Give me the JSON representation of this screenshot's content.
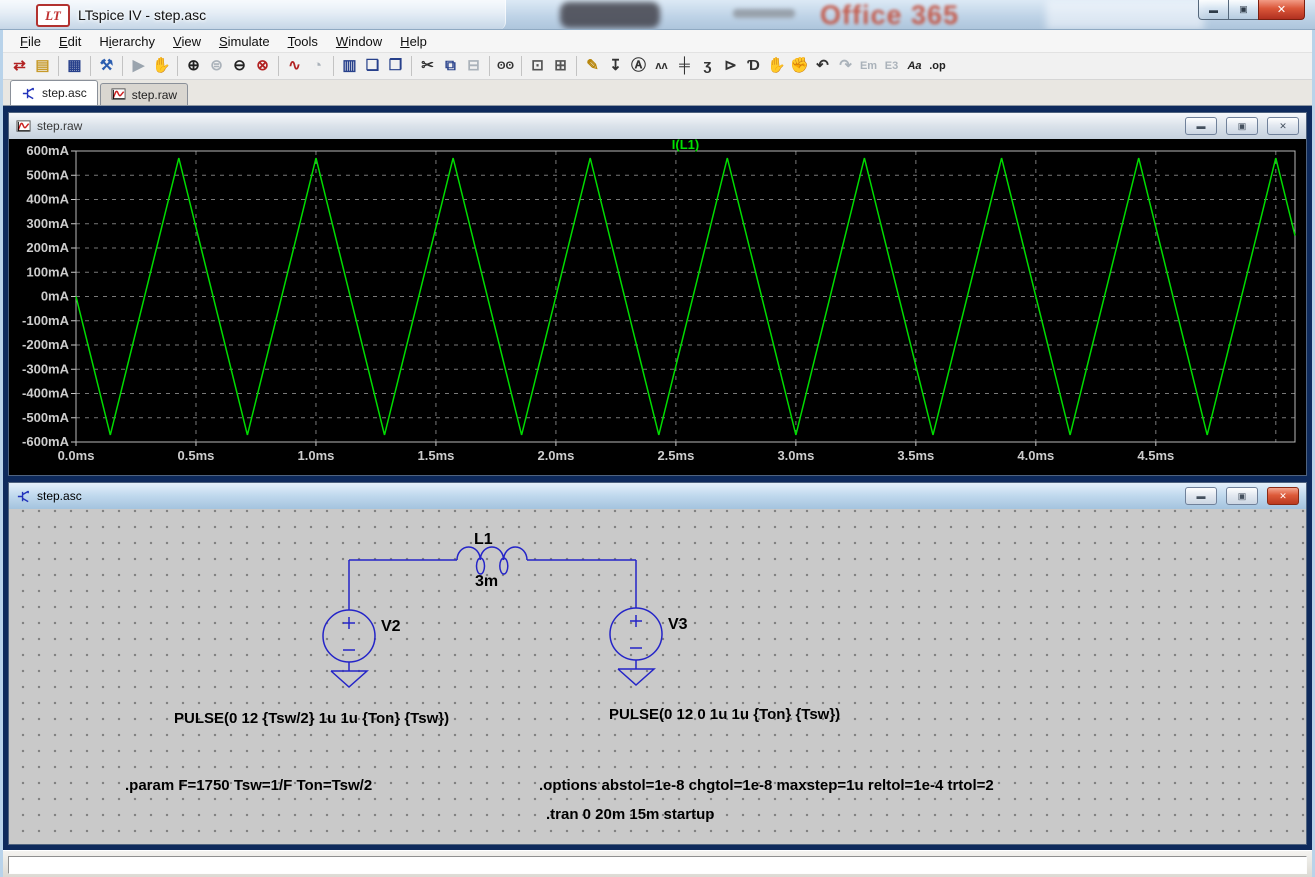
{
  "window": {
    "title": "LTspice IV - step.asc",
    "logo_text": "LT",
    "background": {
      "office_text": "Office 365"
    },
    "controls": {
      "minimize_glyph": "▬",
      "restore_glyph": "▣",
      "close_glyph": "✕"
    }
  },
  "menu": {
    "items": [
      {
        "label": "File",
        "u": 0
      },
      {
        "label": "Edit",
        "u": 0
      },
      {
        "label": "Hierarchy",
        "u": 1
      },
      {
        "label": "View",
        "u": 0
      },
      {
        "label": "Simulate",
        "u": 0
      },
      {
        "label": "Tools",
        "u": 0
      },
      {
        "label": "Window",
        "u": 0
      },
      {
        "label": "Help",
        "u": 0
      }
    ]
  },
  "toolbar": {
    "icons": [
      {
        "name": "new-schematic-button",
        "glyph": "⇄",
        "color": "#b22222"
      },
      {
        "name": "open-file-button",
        "glyph": "▤",
        "color": "#c79a2a"
      },
      {
        "sep": true
      },
      {
        "name": "save-button",
        "glyph": "▦",
        "color": "#27408b"
      },
      {
        "sep": true
      },
      {
        "name": "control-panel-button",
        "glyph": "⚒",
        "color": "#2a5db0"
      },
      {
        "sep": true
      },
      {
        "name": "run-button",
        "glyph": "▶",
        "color": "#9aa4ae",
        "disabled": true
      },
      {
        "name": "halt-button",
        "glyph": "✋",
        "color": "#9aa4ae",
        "disabled": true
      },
      {
        "sep": true
      },
      {
        "name": "zoom-in-button",
        "glyph": "⊕",
        "color": "#222222"
      },
      {
        "name": "zoom-previous-button",
        "glyph": "⊜",
        "color": "#aab2ba",
        "disabled": true
      },
      {
        "name": "zoom-out-button",
        "glyph": "⊖",
        "color": "#222222"
      },
      {
        "name": "zoom-full-extents-button",
        "glyph": "⊗",
        "color": "#b22222"
      },
      {
        "sep": true
      },
      {
        "name": "autorange-waveform-button",
        "glyph": "∿",
        "color": "#b22222"
      },
      {
        "name": "pan-waveform-button",
        "glyph": "◔",
        "color": "#aab2ba",
        "disabled": true
      },
      {
        "sep": true
      },
      {
        "name": "tile-vertically-button",
        "glyph": "▥",
        "color": "#27408b"
      },
      {
        "name": "cascade-windows-button",
        "glyph": "❏",
        "color": "#27408b"
      },
      {
        "name": "tile-horizontally-button",
        "glyph": "❐",
        "color": "#27408b"
      },
      {
        "sep": true
      },
      {
        "name": "cut-button",
        "glyph": "✂",
        "color": "#333333"
      },
      {
        "name": "copy-button",
        "glyph": "⧉",
        "color": "#27408b"
      },
      {
        "name": "paste-button",
        "glyph": "⊟",
        "color": "#aab2ba",
        "disabled": true
      },
      {
        "sep": true
      },
      {
        "name": "find-button",
        "glyph": "ʘʘ",
        "color": "#333333"
      },
      {
        "sep": true
      },
      {
        "name": "print-preview-button",
        "glyph": "⊡",
        "color": "#555555"
      },
      {
        "name": "print-button",
        "glyph": "⊞",
        "color": "#555555"
      },
      {
        "sep": true
      },
      {
        "name": "wire-button",
        "glyph": "✎",
        "color": "#b8860b"
      },
      {
        "name": "ground-button",
        "glyph": "↧",
        "color": "#333333"
      },
      {
        "name": "label-net-button",
        "glyph": "Ⓐ",
        "color": "#333333"
      },
      {
        "name": "resistor-button",
        "glyph": "ʌʌ",
        "color": "#333333"
      },
      {
        "name": "capacitor-button",
        "glyph": "╪",
        "color": "#333333"
      },
      {
        "name": "inductor-button",
        "glyph": "ʒ",
        "color": "#333333"
      },
      {
        "name": "diode-button",
        "glyph": "⊳",
        "color": "#333333"
      },
      {
        "name": "component-button",
        "glyph": "Ɗ",
        "color": "#333333"
      },
      {
        "name": "move-button",
        "glyph": "✋",
        "color": "#222222"
      },
      {
        "name": "drag-button",
        "glyph": "✊",
        "color": "#222222"
      },
      {
        "name": "undo-button",
        "glyph": "↶",
        "color": "#333333"
      },
      {
        "name": "redo-button",
        "glyph": "↷",
        "color": "#aab2ba",
        "disabled": true
      },
      {
        "name": "em-tool-button",
        "glyph": "Em",
        "color": "#aab2ba",
        "disabled": true
      },
      {
        "name": "e3-tool-button",
        "glyph": "E3",
        "color": "#aab2ba",
        "disabled": true
      },
      {
        "name": "text-button",
        "glyph": "Aa",
        "color": "#222222",
        "italic": true
      },
      {
        "name": "spice-directive-button",
        "glyph": ".op",
        "color": "#222222"
      }
    ]
  },
  "tabs": [
    {
      "label": "step.asc",
      "active": true
    },
    {
      "label": "step.raw",
      "active": false
    }
  ],
  "wave_window": {
    "title": "step.raw"
  },
  "chart_data": {
    "type": "line",
    "title": "I(L1)",
    "signal": "I(L1)",
    "trace_color": "#00dc00",
    "title_color": "#00e000",
    "background": "#000000",
    "grid": true,
    "x_unit": "ms",
    "y_unit": "mA",
    "x_range": [
      0,
      5.08
    ],
    "y_range": [
      -600,
      600
    ],
    "x_tick_values": [
      0,
      0.5,
      1.0,
      1.5,
      2.0,
      2.5,
      3.0,
      3.5,
      4.0,
      4.5
    ],
    "x_tick_labels": [
      "0.0ms",
      "0.5ms",
      "1.0ms",
      "1.5ms",
      "2.0ms",
      "2.5ms",
      "3.0ms",
      "3.5ms",
      "4.0ms",
      "4.5ms"
    ],
    "y_tick_values": [
      600,
      500,
      400,
      300,
      200,
      100,
      0,
      -100,
      -200,
      -300,
      -400,
      -500,
      -600
    ],
    "y_tick_labels": [
      "600mA",
      "500mA",
      "400mA",
      "300mA",
      "200mA",
      "100mA",
      "0mA",
      "-100mA",
      "-200mA",
      "-300mA",
      "-400mA",
      "-500mA",
      "-600mA"
    ],
    "waveform": "triangle",
    "period_ms": 0.5714,
    "amplitude_mA": 571,
    "vertices": [
      [
        0,
        0
      ],
      [
        0.1429,
        -571
      ],
      [
        0.4286,
        571
      ],
      [
        0.7143,
        -571
      ],
      [
        1.0,
        571
      ],
      [
        1.2857,
        -571
      ],
      [
        1.5714,
        571
      ],
      [
        1.8571,
        -571
      ],
      [
        2.1429,
        571
      ],
      [
        2.4286,
        -571
      ],
      [
        2.7143,
        571
      ],
      [
        3.0,
        -571
      ],
      [
        3.2857,
        571
      ],
      [
        3.5714,
        -571
      ],
      [
        3.8571,
        571
      ],
      [
        4.1429,
        -571
      ],
      [
        4.4286,
        571
      ],
      [
        4.7143,
        -571
      ],
      [
        5.0,
        571
      ],
      [
        5.08,
        251
      ]
    ]
  },
  "schematic_window": {
    "title": "step.asc",
    "wire_color": "#2424c8",
    "components": {
      "L1": {
        "ref": "L1",
        "value": "3m"
      },
      "V2": {
        "ref": "V2",
        "value": "PULSE(0 12 {Tsw/2} 1u 1u {Ton} {Tsw})"
      },
      "V3": {
        "ref": "V3",
        "value": "PULSE(0 12 0 1u 1u {Ton} {Tsw})"
      }
    },
    "directives": {
      "param": ".param F=1750 Tsw=1/F Ton=Tsw/2",
      "options": ".options abstol=1e-8 chgtol=1e-8 maxstep=1u reltol=1e-4 trtol=2",
      "tran": ".tran 0 20m 15m startup"
    }
  },
  "status_bar": {
    "text": ""
  }
}
